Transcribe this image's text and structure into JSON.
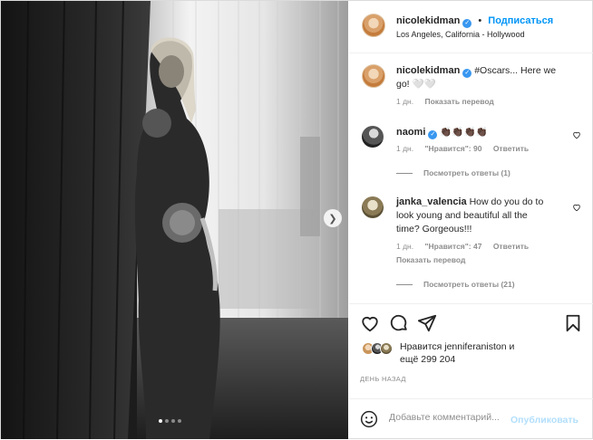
{
  "post": {
    "author": "nicolekidman",
    "follow_label": "Подписаться",
    "separator": "•",
    "location": "Los Angeles, California - Hollywood",
    "carousel": {
      "slides": 4,
      "active_index": 0
    }
  },
  "caption": {
    "username": "nicolekidman",
    "text_line1": "#Oscars... Here we",
    "text_line2": "go! 🤍🤍",
    "time": "1 дн.",
    "translate": "Показать перевод"
  },
  "comments": [
    {
      "username": "naomi",
      "text": "👏🏿👏🏿👏🏿👏🏿",
      "time": "1 дн.",
      "likes": "\"Нравится\": 90",
      "reply": "Ответить",
      "view_replies": "Посмотреть ответы (1)"
    },
    {
      "username": "janka_valencia",
      "text_line1": "How do you do to",
      "text_line2": "look young and beautiful all the",
      "text_line3": "time? Gorgeous!!!",
      "time": "1 дн.",
      "likes": "\"Нравится\": 47",
      "reply": "Ответить",
      "translate": "Показать перевод",
      "view_replies": "Посмотреть ответы (21)"
    }
  ],
  "likes_summary": {
    "line1": "Нравится jenniferaniston и",
    "line2": "ещё 299 204"
  },
  "date_label": "ДЕНЬ НАЗАД",
  "comment_box": {
    "placeholder": "Добавьте комментарий...",
    "publish_label": "Опубликовать"
  },
  "icons": [
    "verified-icon",
    "heart-icon",
    "comment-icon",
    "share-icon",
    "bookmark-icon",
    "emoji-icon",
    "chevron-right-icon"
  ],
  "colors": {
    "accent": "#0095f6",
    "verified": "#3897f0",
    "muted": "#8e8e8e",
    "publish_disabled": "#b2dffc"
  }
}
